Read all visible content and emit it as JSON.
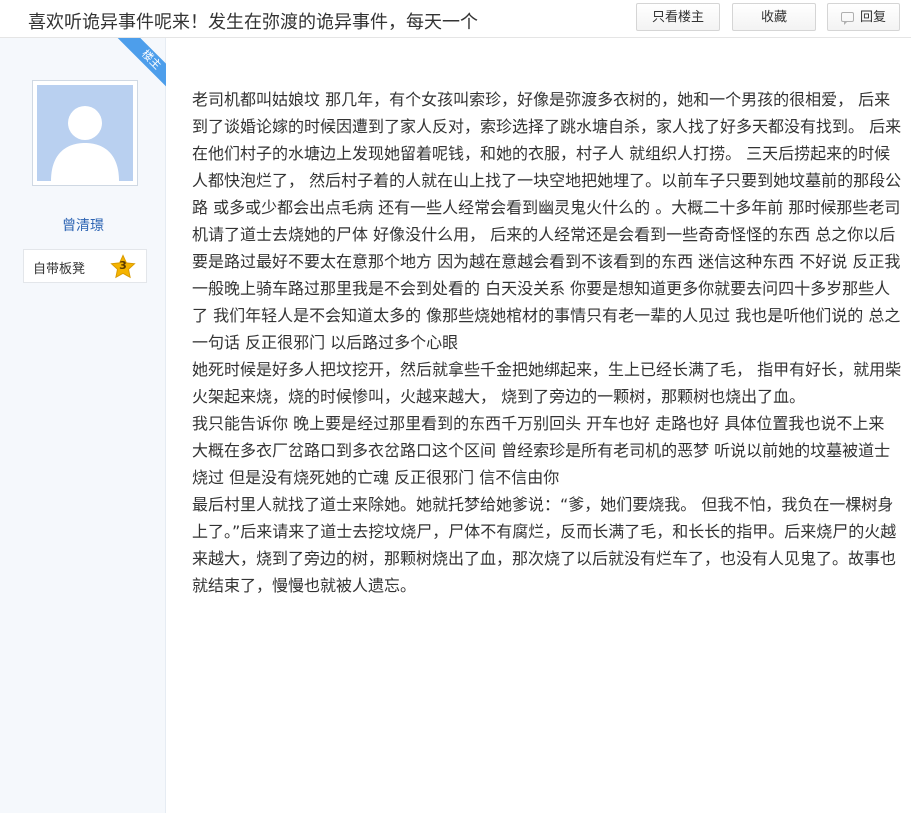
{
  "header": {
    "title": "喜欢听诡异事件呢来！发生在弥渡的诡异事件，每天一个",
    "only_op_label": "只看楼主",
    "favorite_label": "收藏",
    "reply_label": "回复"
  },
  "sidebar": {
    "op_ribbon": "楼主",
    "username": "曾清璟",
    "badge_label": "自带板凳",
    "badge_level": "3"
  },
  "post": {
    "paragraphs": [
      "老司机都叫姑娘坟 那几年，有个女孩叫索珍，好像是弥渡多衣树的，她和一个男孩的很相爱， 后来到了谈婚论嫁的时候因遭到了家人反对，索珍选择了跳水塘自杀，家人找了好多天都没有找到。 后来在他们村子的水塘边上发现她留着呢钱，和她的衣服，村子人 就组织人打捞。 三天后捞起来的时候人都快泡烂了， 然后村子着的人就在山上找了一块空地把她埋了。以前车子只要到她坟墓前的那段公路 或多或少都会出点毛病 还有一些人经常会看到幽灵鬼火什么的 。大概二十多年前 那时候那些老司机请了道士去烧她的尸体 好像没什么用， 后来的人经常还是会看到一些奇奇怪怪的东西 总之你以后要是路过最好不要太在意那个地方 因为越在意越会看到不该看到的东西 迷信这种东西 不好说 反正我一般晚上骑车路过那里我是不会到处看的 白天没关系 你要是想知道更多你就要去问四十多岁那些人了 我们年轻人是不会知道太多的 像那些烧她棺材的事情只有老一辈的人见过 我也是听他们说的 总之一句话 反正很邪门 以后路过多个心眼",
      "她死时候是好多人把坟挖开，然后就拿些千金把她绑起来，生上已经长满了毛， 指甲有好长，就用柴火架起来烧，烧的时候惨叫，火越来越大， 烧到了旁边的一颗树，那颗树也烧出了血。",
      "我只能告诉你 晚上要是经过那里看到的东西千万别回头 开车也好 走路也好 具体位置我也说不上来 大概在多衣厂岔路口到多衣岔路口这个区间 曾经索珍是所有老司机的恶梦 听说以前她的坟墓被道士烧过 但是没有烧死她的亡魂 反正很邪门 信不信由你",
      "最后村里人就找了道士来除她。她就托梦给她爹说：“爹，她们要烧我。 但我不怕，我负在一棵树身上了。”后来请来了道士去挖坟烧尸，尸体不有腐烂，反而长满了毛，和长长的指甲。后来烧尸的火越来越大，烧到了旁边的树，那颗树烧出了血，那次烧了以后就没有烂车了，也没有人见鬼了。故事也就结束了，慢慢也就被人遗忘。"
    ]
  },
  "colors": {
    "accent": "#4d9eeb",
    "username": "#2d64b3",
    "sidebar_bg": "#f5f8fc",
    "star": "#f5b400"
  },
  "icons": {
    "reply": "reply-icon",
    "badge": "star-icon",
    "avatar": "default-avatar-icon"
  }
}
